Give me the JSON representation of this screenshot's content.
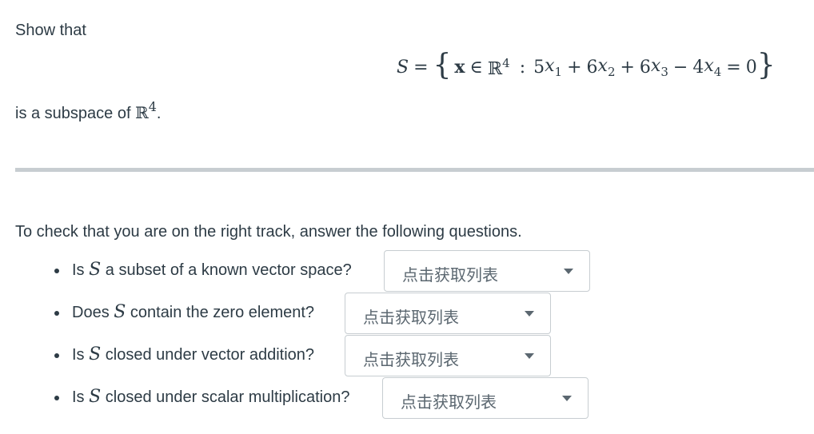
{
  "intro": {
    "lead": "Show that",
    "tail_prefix": "is a subspace of ",
    "tail_space_R": "ℝ",
    "tail_space_exp": "4",
    "tail_suffix": "."
  },
  "formula": {
    "lhs": "S",
    "equals": "=",
    "open_brace": "{",
    "vector": "x",
    "in": "∈",
    "space_R": "ℝ",
    "space_exp": "4",
    "colon": ":",
    "coef1": "5",
    "var1": "x",
    "sub1": "1",
    "plus1": "+",
    "coef2": "6",
    "var2": "x",
    "sub2": "2",
    "plus2": "+",
    "coef3": "6",
    "var3": "x",
    "sub3": "3",
    "minus": "−",
    "coef4": "4",
    "var4": "x",
    "sub4": "4",
    "eq": "=",
    "rhs": "0",
    "close_brace": "}"
  },
  "check_intro": "To check that you are on the right track, answer the following questions.",
  "questions": [
    {
      "pre": "Is ",
      "symbol": "S",
      "post": " a subset of a known vector space?",
      "select_placeholder": "点击获取列表"
    },
    {
      "pre": "Does ",
      "symbol": "S",
      "post": " contain the zero element?",
      "select_placeholder": "点击获取列表"
    },
    {
      "pre": "Is ",
      "symbol": "S",
      "post": " closed under vector addition?",
      "select_placeholder": "点击获取列表"
    },
    {
      "pre": "Is ",
      "symbol": "S",
      "post": " closed under scalar multiplication?",
      "select_placeholder": "点击获取列表"
    }
  ],
  "colors": {
    "text": "#2d3b45",
    "divider": "#c7cdd1",
    "select_border": "#c7cdd1",
    "placeholder": "#5b6770"
  }
}
